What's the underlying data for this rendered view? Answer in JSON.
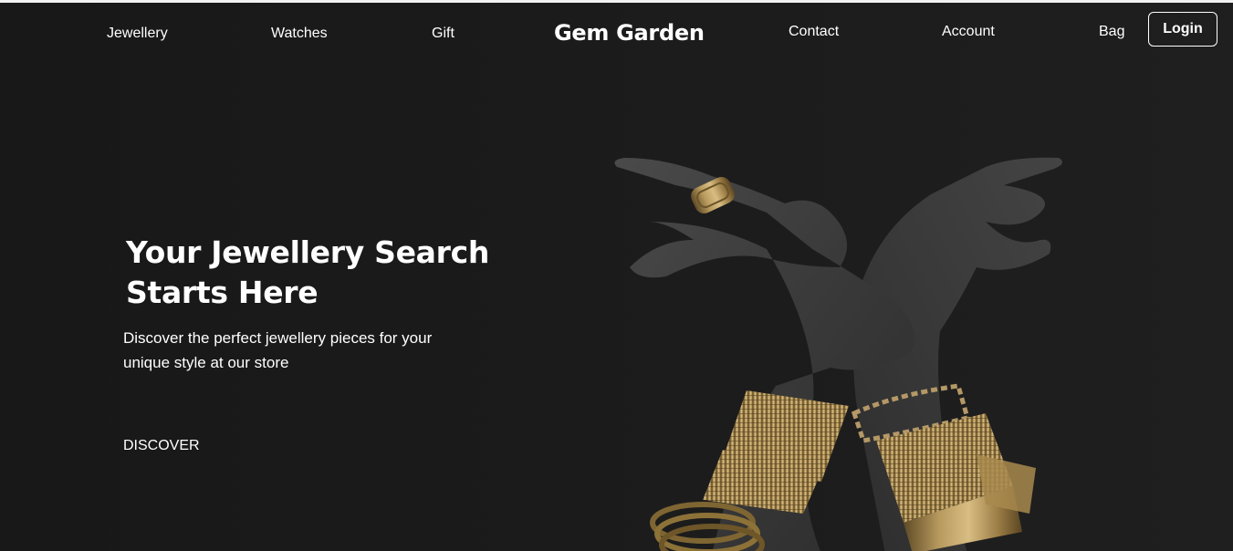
{
  "nav": {
    "links": [
      "Jewellery",
      "Watches",
      "Gift",
      "Contact",
      "Account",
      "Bag"
    ],
    "brand": "Gem Garden",
    "login_label": "Login"
  },
  "hero": {
    "title_line1": "Your Jewellery Search",
    "title_line2": "Starts Here",
    "subtitle": "Discover the perfect jewellery pieces for your unique style at our store",
    "cta_label": "DISCOVER",
    "image": "crossed-hands-with-gold-bangles-and-ring"
  },
  "colors": {
    "background": "#1b1b1b",
    "text": "#ffffff",
    "gold": "#a88a4e"
  }
}
